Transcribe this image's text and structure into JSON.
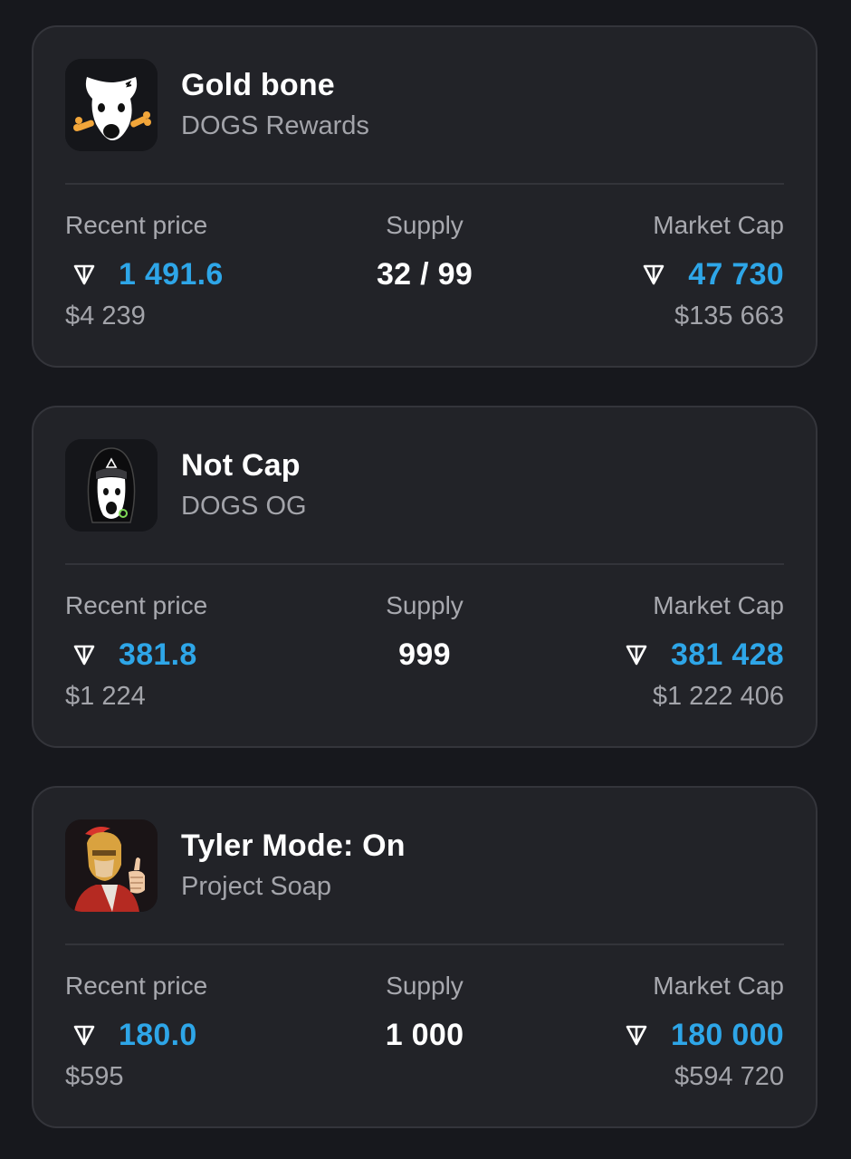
{
  "colors": {
    "background": "#17181d",
    "card": "#222328",
    "accent": "#2ea6e8",
    "muted_text": "#a3a4aa"
  },
  "labels": {
    "recent_price": "Recent price",
    "supply": "Supply",
    "market_cap": "Market Cap"
  },
  "items": [
    {
      "name": "Gold bone",
      "collection": "DOGS Rewards",
      "avatar_icon": "dog-with-bone-icon",
      "recent_price_ton": "1 491.6",
      "recent_price_usd": "$4 239",
      "supply": "32 / 99",
      "market_cap_ton": "47 730",
      "market_cap_usd": "$135 663"
    },
    {
      "name": "Not Cap",
      "collection": "DOGS OG",
      "avatar_icon": "dog-in-black-hood-icon",
      "recent_price_ton": "381.8",
      "recent_price_usd": "$1 224",
      "supply": "999",
      "market_cap_ton": "381 428",
      "market_cap_usd": "$1 222 406"
    },
    {
      "name": "Tyler Mode: On",
      "collection": "Project Soap",
      "avatar_icon": "helmeted-man-thumbs-up-icon",
      "recent_price_ton": "180.0",
      "recent_price_usd": "$595",
      "supply": "1 000",
      "market_cap_ton": "180 000",
      "market_cap_usd": "$594 720"
    }
  ]
}
